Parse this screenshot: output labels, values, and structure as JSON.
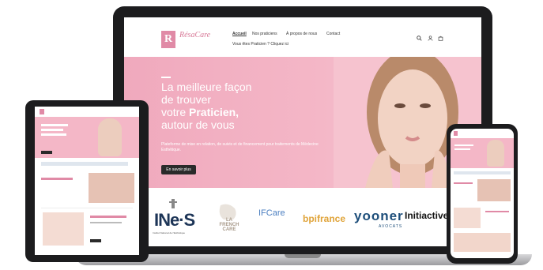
{
  "brand": {
    "logo_letter": "R",
    "name": "RésaCare"
  },
  "nav": {
    "items": [
      "Accueil",
      "Nos praticiens",
      "À propos de nous",
      "Contact"
    ],
    "active": "Accueil",
    "sub": "Vous êtes Praticien ? Cliquez ici",
    "icons": [
      "search-icon",
      "user-icon",
      "cart-icon"
    ]
  },
  "hero": {
    "title_1": "La meilleure façon",
    "title_2": "de trouver",
    "title_3a": "votre ",
    "title_3b": "Praticien,",
    "title_4": "autour de vous",
    "desc": "Plateforme de mise en relation, de suivis et de financement pour traitements de Médecine Esthétique.",
    "button": "En savoir plus"
  },
  "partners": {
    "ines": "INe·S",
    "ines_sub": "Institut National de l'Esthétique",
    "french_care": "LA FRENCH CARE",
    "ifcare": "IFCare",
    "bpi": "bpifrance",
    "yooner": "yooner",
    "yooner_sub": "AVOCATS",
    "initiative": "Initiactive",
    "initiative_num": "89"
  },
  "colors": {
    "accent": "#e08aa6",
    "hero_pink": "#f4b7c7",
    "dark": "#1c1c1e"
  }
}
